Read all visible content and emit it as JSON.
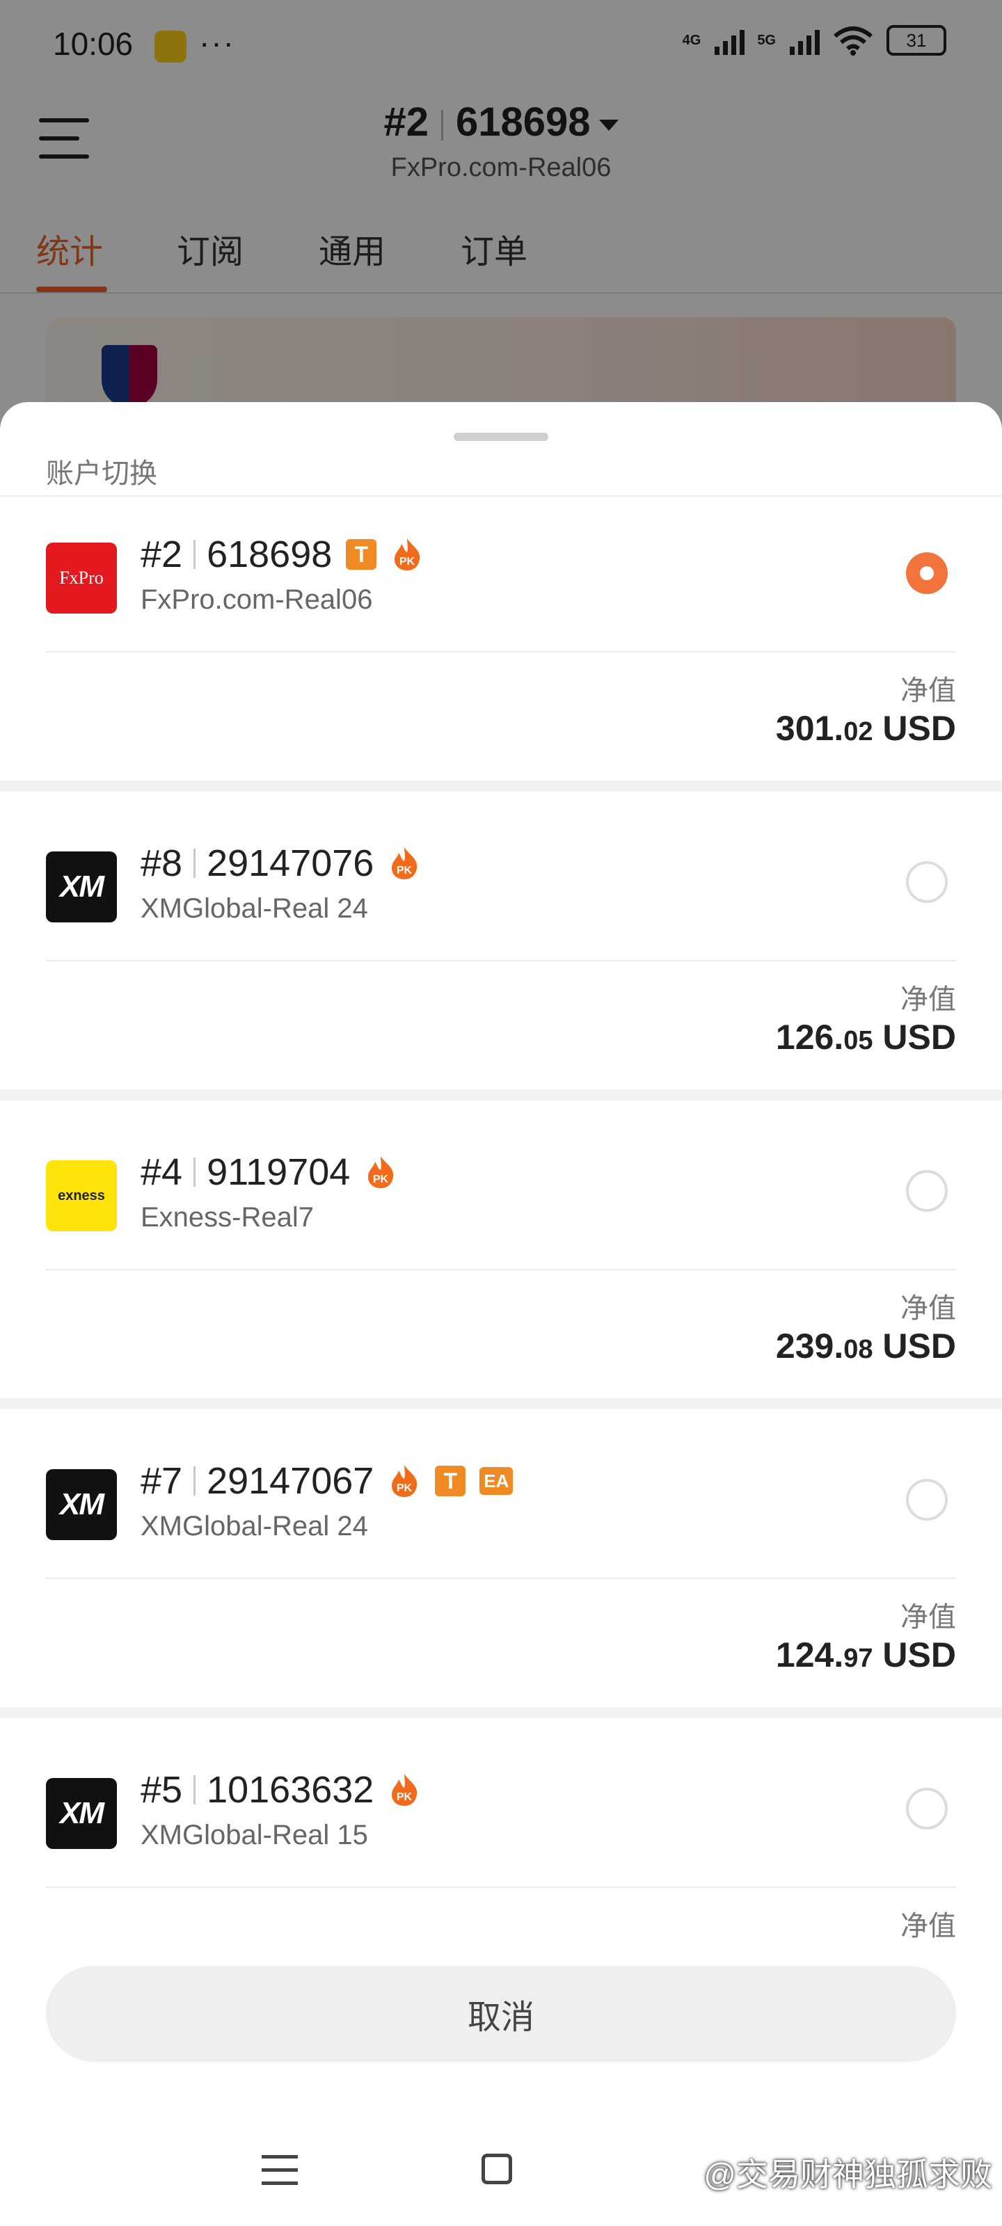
{
  "status_bar": {
    "time": "10:06",
    "dots": "···",
    "net1": "4G",
    "net2": "5G",
    "battery": "31"
  },
  "header": {
    "account_number": "#2",
    "account_id": "618698",
    "server": "FxPro.com-Real06"
  },
  "tabs": [
    "统计",
    "订阅",
    "通用",
    "订单"
  ],
  "sheet": {
    "title": "账户切换",
    "net_value_label": "净值",
    "accounts": [
      {
        "num": "#2",
        "id": "618698",
        "server": "FxPro.com-Real06",
        "logo": "FxPro",
        "badges": [
          "T",
          "PK"
        ],
        "selected": true,
        "value_int": "301.",
        "value_dec": "02",
        "currency": " USD"
      },
      {
        "num": "#8",
        "id": "29147076",
        "server": "XMGlobal-Real 24",
        "logo": "XM",
        "badges": [
          "PK"
        ],
        "selected": false,
        "value_int": "126.",
        "value_dec": "05",
        "currency": " USD"
      },
      {
        "num": "#4",
        "id": "9119704",
        "server": "Exness-Real7",
        "logo": "exness",
        "badges": [
          "PK"
        ],
        "selected": false,
        "value_int": "239.",
        "value_dec": "08",
        "currency": " USD"
      },
      {
        "num": "#7",
        "id": "29147067",
        "server": "XMGlobal-Real 24",
        "logo": "XM",
        "badges": [
          "PK",
          "T",
          "EA"
        ],
        "selected": false,
        "value_int": "124.",
        "value_dec": "97",
        "currency": " USD"
      },
      {
        "num": "#5",
        "id": "10163632",
        "server": "XMGlobal-Real 15",
        "logo": "XM",
        "badges": [
          "PK"
        ],
        "selected": false
      }
    ],
    "cancel_label": "取消"
  },
  "watermark": "@交易财神独孤求败",
  "colors": {
    "accent": "#e8642c",
    "radio_selected": "#f2733c",
    "badge": "#f08a24"
  }
}
